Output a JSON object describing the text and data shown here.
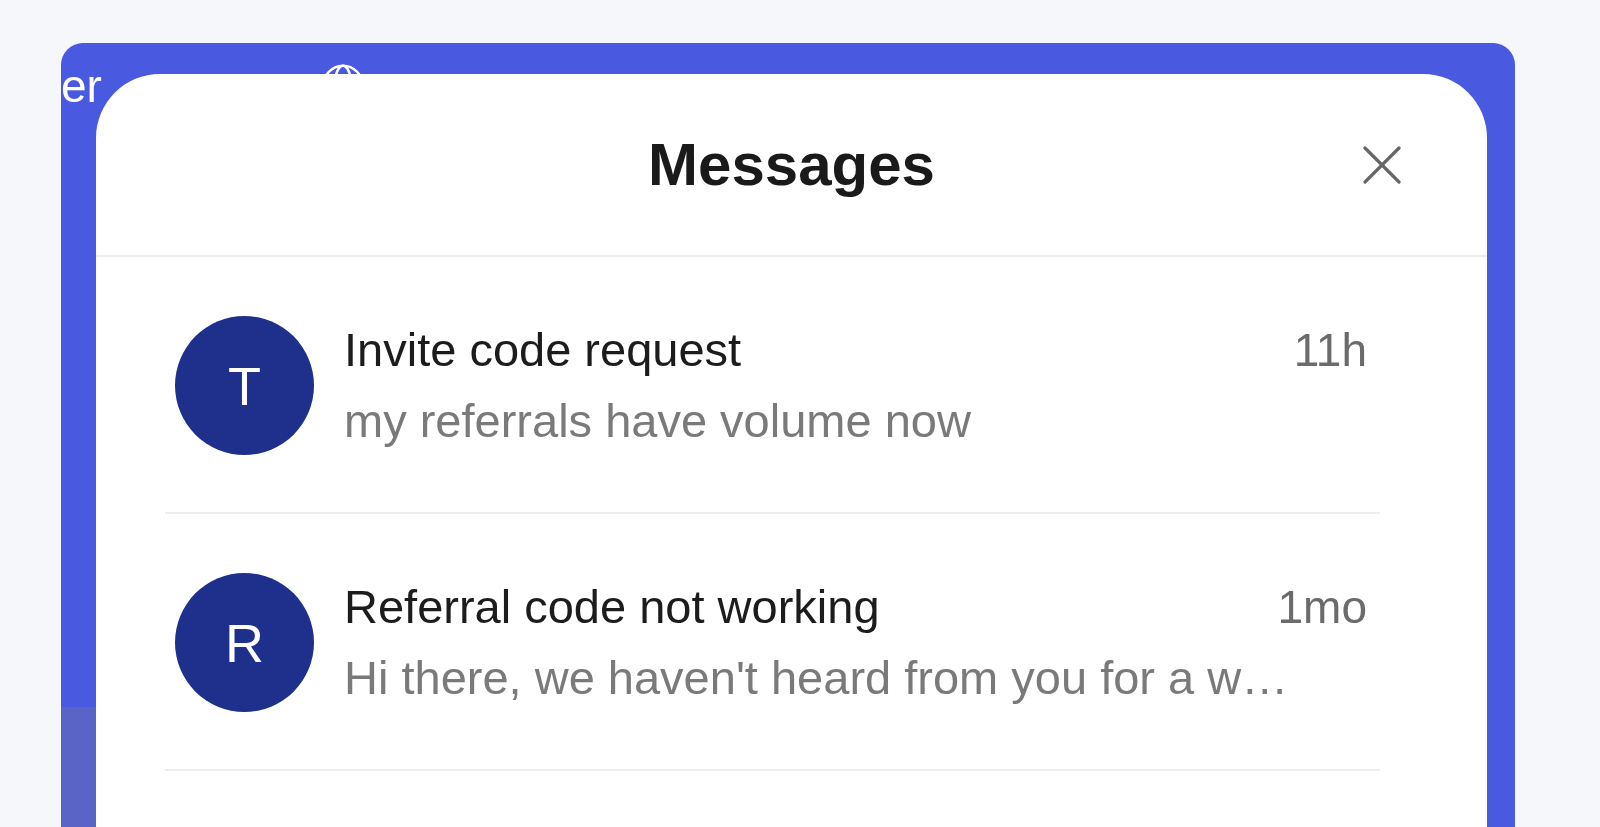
{
  "background_page": {
    "header_fragment": "er"
  },
  "dialog": {
    "title": "Messages"
  },
  "messages": [
    {
      "initial": "T",
      "title": "Invite code request",
      "time": "11h",
      "preview": "my referrals have volume now"
    },
    {
      "initial": "R",
      "title": "Referral code not working",
      "time": "1mo",
      "preview": "Hi there, we haven't heard from you for a w…"
    }
  ]
}
